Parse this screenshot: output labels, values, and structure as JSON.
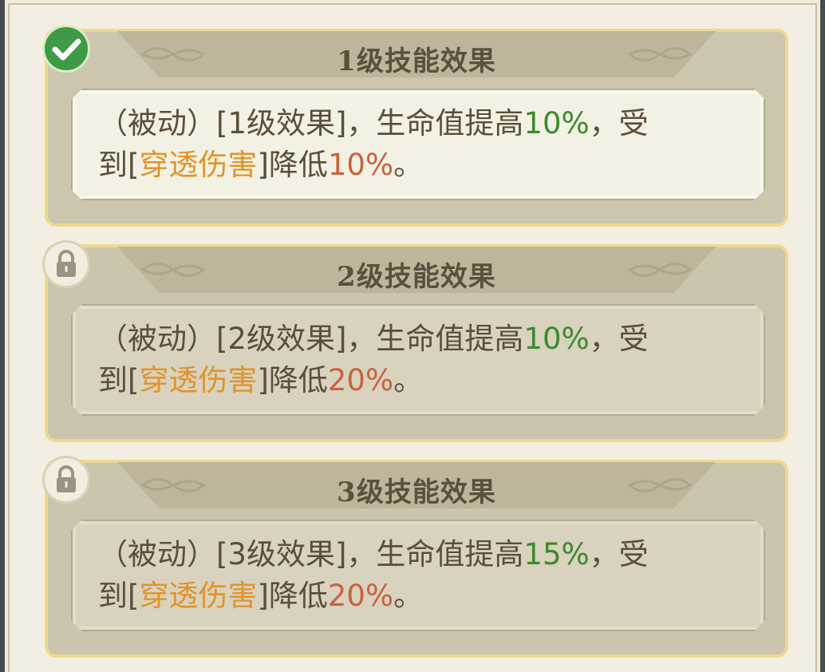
{
  "levels": [
    {
      "title": "1级技能效果",
      "status": "unlocked",
      "icon": "check-icon",
      "desc": {
        "prefix": "（被动）[1级效果]，生命值提高",
        "hp_value": "10%",
        "mid1": "，受",
        "line2_start": "到[",
        "damage_type": "穿透伤害",
        "mid2": "]降低",
        "reduce_value": "10%",
        "suffix": "。"
      }
    },
    {
      "title": "2级技能效果",
      "status": "locked",
      "icon": "lock-icon",
      "desc": {
        "prefix": "（被动）[2级效果]，生命值提高",
        "hp_value": "10%",
        "mid1": "，受",
        "line2_start": "到[",
        "damage_type": "穿透伤害",
        "mid2": "]降低",
        "reduce_value": "20%",
        "suffix": "。"
      }
    },
    {
      "title": "3级技能效果",
      "status": "locked",
      "icon": "lock-icon",
      "desc": {
        "prefix": "（被动）[3级效果]，生命值提高",
        "hp_value": "15%",
        "mid1": "，受",
        "line2_start": "到[",
        "damage_type": "穿透伤害",
        "mid2": "]降低",
        "reduce_value": "20%",
        "suffix": "。"
      }
    }
  ],
  "colors": {
    "hp_value": "#3b8a2e",
    "damage_type": "#e1932a",
    "reduce_value": "#c9623e",
    "gold_border": "#f1d98a"
  }
}
